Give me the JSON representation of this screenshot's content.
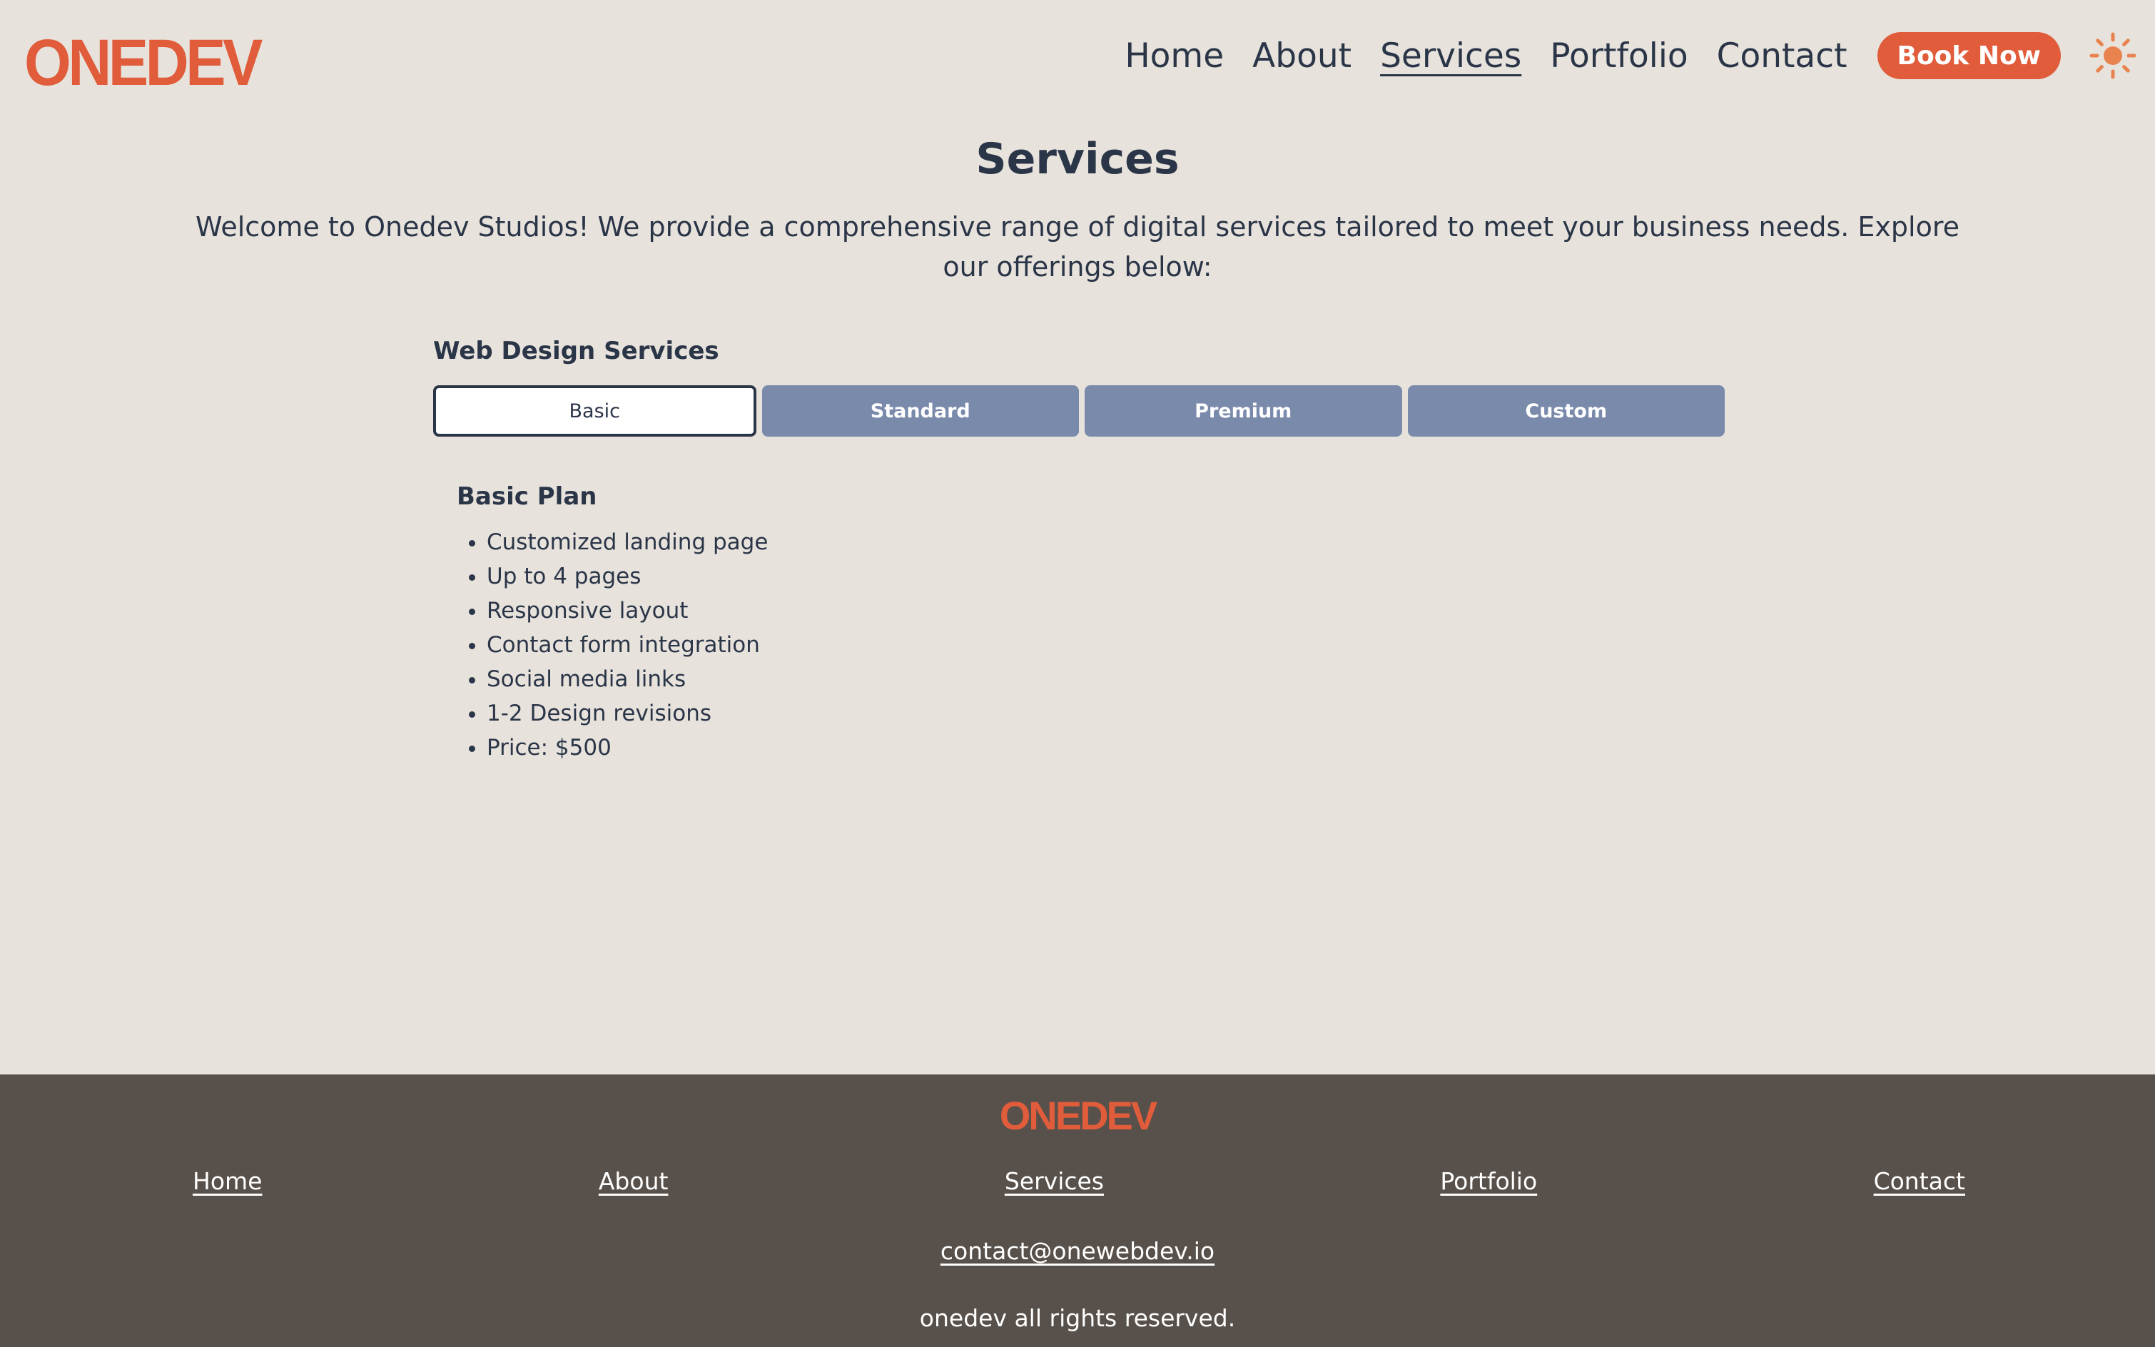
{
  "header": {
    "logo": "ONEDEV",
    "nav": [
      {
        "label": "Home"
      },
      {
        "label": "About"
      },
      {
        "label": "Services",
        "active": true
      },
      {
        "label": "Portfolio"
      },
      {
        "label": "Contact"
      }
    ],
    "cta_label": "Book Now",
    "theme_icon": "sun-icon"
  },
  "main": {
    "title": "Services",
    "intro": "Welcome to Onedev Studios! We provide a comprehensive range of digital services tailored to meet your business needs. Explore our offerings below:",
    "section_heading": "Web Design Services",
    "tabs": [
      {
        "label": "Basic",
        "selected": true
      },
      {
        "label": "Standard"
      },
      {
        "label": "Premium"
      },
      {
        "label": "Custom"
      }
    ],
    "plan": {
      "title": "Basic Plan",
      "features": [
        "Customized landing page",
        "Up to 4 pages",
        "Responsive layout",
        "Contact form integration",
        "Social media links",
        "1-2 Design revisions",
        "Price: $500"
      ]
    }
  },
  "footer": {
    "logo": "ONEDEV",
    "links": [
      {
        "label": "Home"
      },
      {
        "label": "About"
      },
      {
        "label": "Services"
      },
      {
        "label": "Portfolio"
      },
      {
        "label": "Contact"
      }
    ],
    "email": "contact@onewebdev.io",
    "copyright": "onedev all rights reserved."
  },
  "colors": {
    "background": "#e7e3dc",
    "accent": "#e05c3a",
    "text": "#2b3548",
    "tab_inactive": "#7a8aab",
    "footer_bg": "#58504a"
  }
}
